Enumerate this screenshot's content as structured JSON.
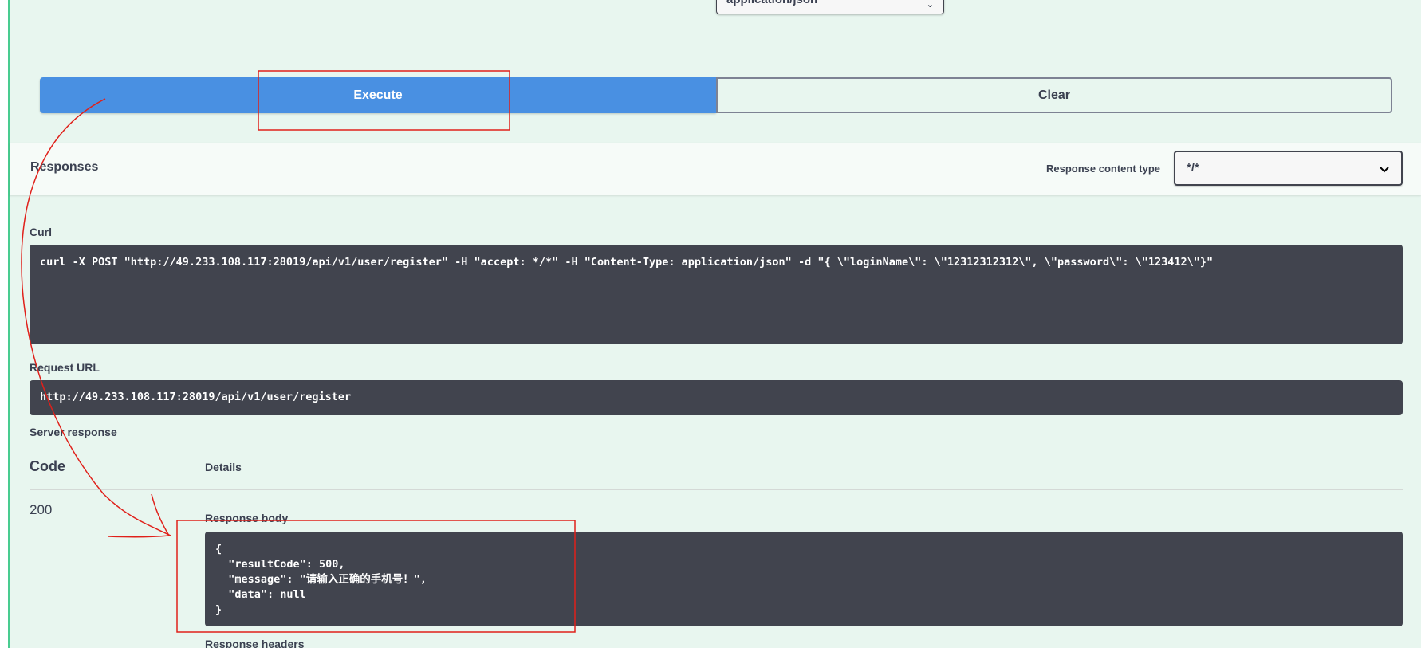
{
  "top_select": {
    "value": "application/json"
  },
  "actions": {
    "execute_label": "Execute",
    "clear_label": "Clear"
  },
  "responses": {
    "title": "Responses",
    "content_type_label": "Response content type",
    "content_type_value": "*/*"
  },
  "curl": {
    "label": "Curl",
    "command": "curl -X POST \"http://49.233.108.117:28019/api/v1/user/register\" -H \"accept: */*\" -H \"Content-Type: application/json\" -d \"{ \\\"loginName\\\": \\\"12312312312\\\", \\\"password\\\": \\\"123412\\\"}\""
  },
  "request_url": {
    "label": "Request URL",
    "value": "http://49.233.108.117:28019/api/v1/user/register"
  },
  "server_response": {
    "label": "Server response",
    "col_code": "Code",
    "col_details": "Details",
    "status_code": "200",
    "body_label": "Response body",
    "body": "{\n  \"resultCode\": 500,\n  \"message\": \"请输入正确的手机号！\",\n  \"data\": null\n}",
    "headers_label": "Response headers"
  },
  "colors": {
    "execute_bg": "#4990e2",
    "block_bg": "#e8f6ef",
    "code_bg": "#41444e",
    "annotation_red": "#e0201a"
  },
  "icons": [
    "chevron-down-icon"
  ]
}
